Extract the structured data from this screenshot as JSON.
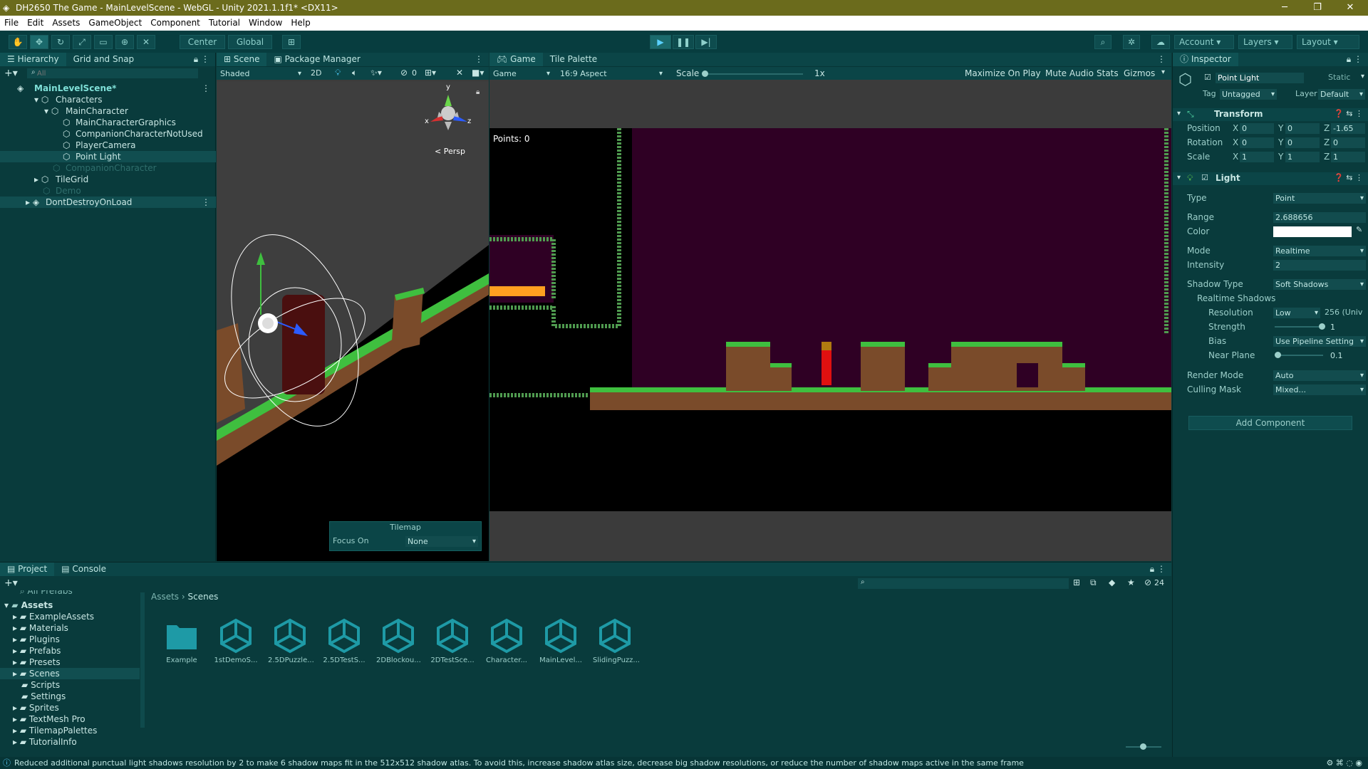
{
  "window": {
    "title": "DH2650 The Game - MainLevelScene - WebGL - Unity 2021.1.1f1* <DX11>",
    "minimize": "─",
    "maximize": "❐",
    "close": "✕"
  },
  "menu": [
    "File",
    "Edit",
    "Assets",
    "GameObject",
    "Component",
    "Tutorial",
    "Window",
    "Help"
  ],
  "toolbar": {
    "center": "Center",
    "global": "Global",
    "account": "Account",
    "layers": "Layers",
    "layout": "Layout"
  },
  "hierarchy": {
    "tabs": [
      "Hierarchy",
      "Grid and Snap"
    ],
    "search_placeholder": "All",
    "items": [
      {
        "label": "MainLevelScene*"
      },
      {
        "label": "Characters"
      },
      {
        "label": "MainCharacter"
      },
      {
        "label": "MainCharacterGraphics"
      },
      {
        "label": "CompanionCharacterNotUsed"
      },
      {
        "label": "PlayerCamera"
      },
      {
        "label": "Point Light"
      },
      {
        "label": "CompanionCharacter"
      },
      {
        "label": "TileGrid"
      },
      {
        "label": "Demo"
      },
      {
        "label": "DontDestroyOnLoad"
      }
    ]
  },
  "scene": {
    "tabs": [
      "Scene",
      "Package Manager"
    ],
    "shading": "Shaded",
    "mode2d": "2D",
    "hidden_count": "0",
    "persp": "< Persp",
    "axes": {
      "x": "x",
      "y": "y",
      "z": "z"
    },
    "tilemap": {
      "title": "Tilemap",
      "focus_label": "Focus On",
      "focus_value": "None"
    }
  },
  "game": {
    "tabs": [
      "Game",
      "Tile Palette"
    ],
    "display": "Game",
    "aspect": "16:9 Aspect",
    "scale_label": "Scale",
    "scale_value": "1x",
    "maximize": "Maximize On Play",
    "mute": "Mute Audio",
    "stats": "Stats",
    "gizmos": "Gizmos",
    "points": "Points: 0"
  },
  "inspector": {
    "tab": "Inspector",
    "object_name": "Point Light",
    "static": "Static",
    "tag_label": "Tag",
    "tag_value": "Untagged",
    "layer_label": "Layer",
    "layer_value": "Default",
    "transform": {
      "title": "Transform",
      "position": {
        "label": "Position",
        "x": "0",
        "y": "0",
        "z": "-1.65"
      },
      "rotation": {
        "label": "Rotation",
        "x": "0",
        "y": "0",
        "z": "0"
      },
      "scale": {
        "label": "Scale",
        "x": "1",
        "y": "1",
        "z": "1"
      }
    },
    "light": {
      "title": "Light",
      "type_label": "Type",
      "type_value": "Point",
      "range_label": "Range",
      "range_value": "2.688656",
      "color_label": "Color",
      "color_value": "#ffffff",
      "mode_label": "Mode",
      "mode_value": "Realtime",
      "intensity_label": "Intensity",
      "intensity_value": "2",
      "shadow_type_label": "Shadow Type",
      "shadow_type_value": "Soft Shadows",
      "realtime_shadows": "Realtime Shadows",
      "resolution_label": "Resolution",
      "resolution_value": "Low",
      "resolution_note": "256 (Univ",
      "strength_label": "Strength",
      "strength_value": "1",
      "strength_fraction": 1.0,
      "bias_label": "Bias",
      "bias_value": "Use Pipeline Setting",
      "near_plane_label": "Near Plane",
      "near_plane_value": "0.1",
      "near_plane_fraction": 0.0,
      "render_mode_label": "Render Mode",
      "render_mode_value": "Auto",
      "culling_mask_label": "Culling Mask",
      "culling_mask_value": "Mixed..."
    },
    "add_component": "Add Component"
  },
  "project": {
    "tabs": [
      "Project",
      "Console"
    ],
    "hidden_count": "24",
    "tree_scrolled_top": "All Prefabs",
    "tree_root": "Assets",
    "tree": [
      "ExampleAssets",
      "Materials",
      "Plugins",
      "Prefabs",
      "Presets",
      "Scenes",
      "Scripts",
      "Settings",
      "Sprites",
      "TextMesh Pro",
      "TilemapPalettes",
      "TutorialInfo"
    ],
    "breadcrumb": [
      "Assets",
      "Scenes"
    ],
    "assets": [
      {
        "label": "Example",
        "icon": "folder-icon"
      },
      {
        "label": "1stDemoS...",
        "icon": "unity-scene-icon"
      },
      {
        "label": "2.5DPuzzle...",
        "icon": "unity-scene-icon"
      },
      {
        "label": "2.5DTestS...",
        "icon": "unity-scene-icon"
      },
      {
        "label": "2DBlockou...",
        "icon": "unity-scene-icon"
      },
      {
        "label": "2DTestSce...",
        "icon": "unity-scene-icon"
      },
      {
        "label": "Character...",
        "icon": "unity-scene-icon"
      },
      {
        "label": "MainLevel...",
        "icon": "unity-scene-icon"
      },
      {
        "label": "SlidingPuzz...",
        "icon": "unity-scene-icon"
      }
    ]
  },
  "status": {
    "message": "Reduced additional punctual light shadows resolution by 2 to make 6 shadow maps fit in the 512x512 shadow atlas. To avoid this, increase shadow atlas size, decrease big shadow resolutions, or reduce the number of shadow maps active in the same frame"
  },
  "colors": {
    "teal_bg": "#0a3a3a",
    "game_bg": "#2f0024",
    "ground": "#7a4b2a",
    "grass": "#3fbf3f",
    "title_bar": "#6b6b1c"
  }
}
